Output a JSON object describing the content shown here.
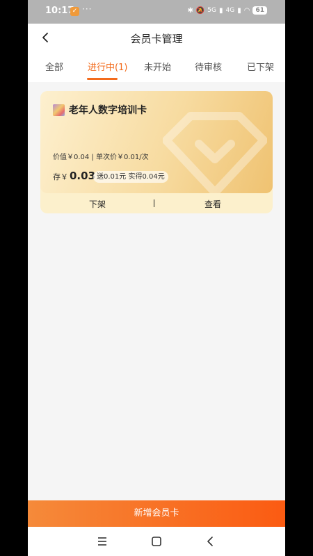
{
  "status_bar": {
    "time": "10:17",
    "dots": "···",
    "signal_1": "5G",
    "signal_2": "4G",
    "battery": "61"
  },
  "header": {
    "title": "会员卡管理"
  },
  "tabs": [
    {
      "label": "全部",
      "active": false
    },
    {
      "label": "进行中(1)",
      "active": true
    },
    {
      "label": "未开始",
      "active": false
    },
    {
      "label": "待审核",
      "active": false
    },
    {
      "label": "已下架",
      "active": false
    }
  ],
  "card": {
    "title": "老年人数字培训卡",
    "price_line": "价值￥0.04 | 单次价￥0.01/次",
    "store_label": "存￥",
    "store_amount": "0.03",
    "bonus": "送0.01元  实得0.04元",
    "actions": {
      "offline_label": "下架",
      "view_label": "查看"
    }
  },
  "bottom": {
    "add_button_label": "新增会员卡"
  },
  "colors": {
    "accent": "#f36b1c",
    "card_gradient_start": "#fdf0cf",
    "card_gradient_end": "#efc271"
  }
}
